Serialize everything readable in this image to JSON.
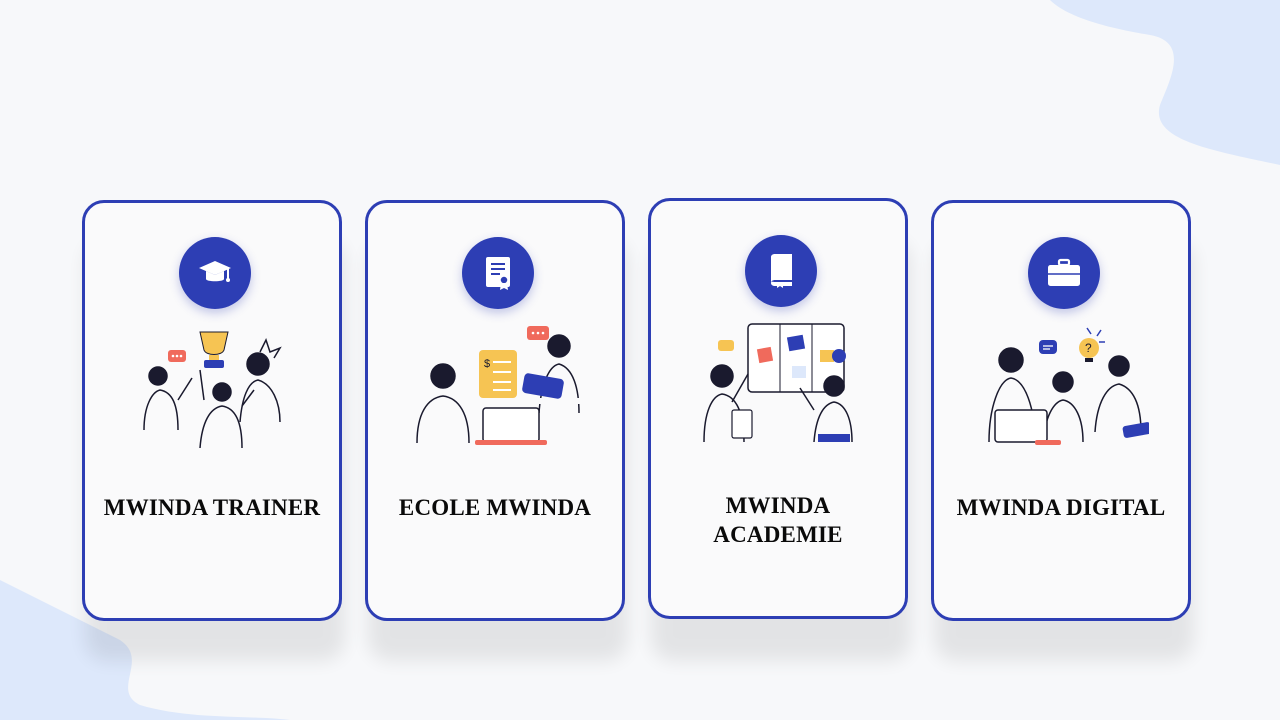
{
  "colors": {
    "accent": "#2d3eb4",
    "background": "#f7f8fa",
    "blob": "#dde8fb",
    "illus_yellow": "#f6c453",
    "illus_red": "#f06a5c"
  },
  "cards": [
    {
      "title": "MWINDA TRAINER",
      "icon": "graduation-cap-icon",
      "illustration": "team-celebration-trophy"
    },
    {
      "title": "ECOLE MWINDA",
      "icon": "certificate-document-icon",
      "illustration": "people-reviewing-document-laptop"
    },
    {
      "title": "MWINDA ACADEMIE",
      "icon": "book-icon",
      "illustration": "people-at-board"
    },
    {
      "title": "MWINDA DIGITAL",
      "icon": "briefcase-icon",
      "illustration": "team-working-laptop-idea"
    }
  ]
}
